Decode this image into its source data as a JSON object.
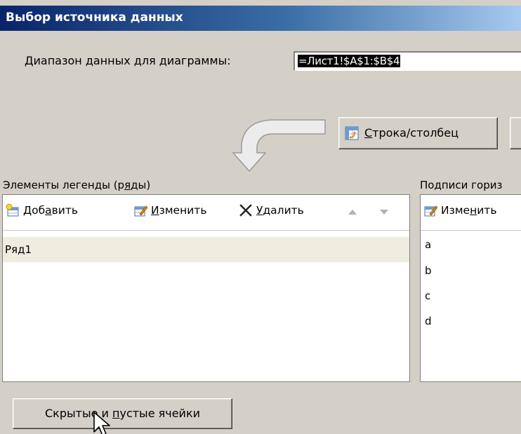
{
  "dialog": {
    "title": "Выбор источника данных"
  },
  "data_range": {
    "label_pre": "",
    "label_accel": "Д",
    "label_post": "иапазон данных для диаграммы:",
    "value": "=Лист1!$A$1:$B$4"
  },
  "switch_button": {
    "pre": "",
    "accel": "С",
    "post": "трока/столбец"
  },
  "legend": {
    "label_pre": "Элементы легенды (р",
    "label_accel": "я",
    "label_post": "ды)",
    "toolbar": {
      "add": {
        "pre": "Доб",
        "accel": "а",
        "post": "вить"
      },
      "edit": {
        "pre": "",
        "accel": "И",
        "post": "зменить"
      },
      "delete": {
        "pre": "",
        "accel": "У",
        "post": "далить"
      }
    },
    "series": [
      "Ряд1"
    ]
  },
  "axis": {
    "label": "Подписи гориз",
    "edit": {
      "pre": "Изме",
      "accel": "н",
      "post": "ить"
    },
    "items": [
      "a",
      "b",
      "c",
      "d"
    ]
  },
  "hidden_cells_button": {
    "pre": "Скрытые и ",
    "accel": "п",
    "post": "устые ячейки"
  },
  "colors": {
    "dialog_bg": "#d4d0c8",
    "title_start": "#0a246a",
    "title_end": "#a6caf0",
    "selection_bg": "#000000",
    "row_selected": "#efede0"
  }
}
